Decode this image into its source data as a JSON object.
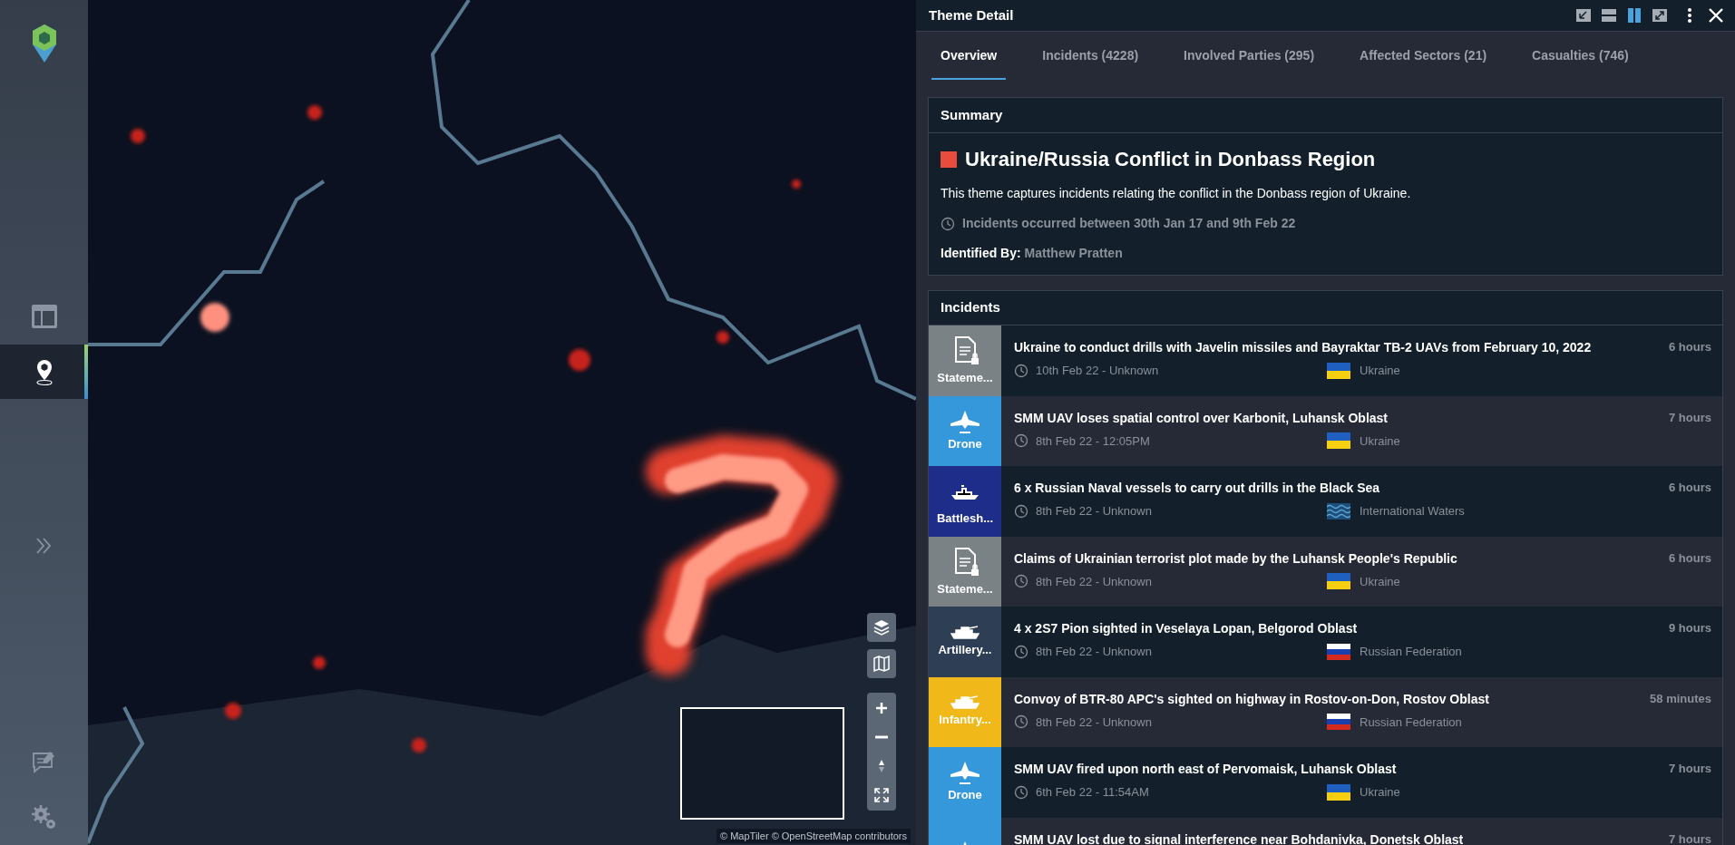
{
  "sidebar": {
    "items": [
      {
        "kind": "layout",
        "selected": false
      },
      {
        "kind": "pin",
        "selected": true
      }
    ],
    "bottom": [
      {
        "kind": "expand"
      },
      {
        "kind": "chat"
      },
      {
        "kind": "settings"
      }
    ]
  },
  "map": {
    "attribution": "© MapTiler © OpenStreetMap contributors"
  },
  "panel": {
    "title": "Theme Detail",
    "view_buttons": [
      {
        "kind": "dock",
        "selected": false
      },
      {
        "kind": "rows",
        "selected": false
      },
      {
        "kind": "columns",
        "selected": true
      },
      {
        "kind": "expand",
        "selected": false
      }
    ]
  },
  "tabs": [
    {
      "label": "Overview",
      "selected": true
    },
    {
      "label": "Incidents (4228)",
      "selected": false
    },
    {
      "label": "Involved Parties (295)",
      "selected": false
    },
    {
      "label": "Affected Sectors (21)",
      "selected": false
    },
    {
      "label": "Casualties (746)",
      "selected": false
    }
  ],
  "summary": {
    "heading": "Summary",
    "title": "Ukraine/Russia Conflict in Donbass Region",
    "description": "This theme captures incidents relating the conflict in the Donbass region of Ukraine.",
    "period": "Incidents occurred between 30th Jan 17 and 9th Feb 22",
    "identified_label": "Identified By:",
    "identified_name": "Matthew Pratten"
  },
  "incidents": {
    "heading": "Incidents",
    "items": [
      {
        "kind": "document",
        "category": "Stateme...",
        "color": "#7a8285",
        "title": "Ukraine to conduct drills with Javelin missiles and Bayraktar TB-2 UAVs from February 10, 2022",
        "date": "10th Feb 22 - Unknown",
        "flag": {
          "kind": "ukraine"
        },
        "country": "Ukraine",
        "age": "6 hours"
      },
      {
        "kind": "drone",
        "category": "Drone",
        "color": "#3498db",
        "title": "SMM UAV loses spatial control over Karbonit, Luhansk Oblast",
        "date": "8th Feb 22 - 12:05PM",
        "flag": {
          "kind": "ukraine"
        },
        "country": "Ukraine",
        "age": "7 hours"
      },
      {
        "kind": "ship",
        "category": "Battlesh...",
        "color": "#1f2d8a",
        "title": "6 x Russian Naval vessels to carry out drills in the Black Sea",
        "date": "8th Feb 22 - Unknown",
        "flag": {
          "kind": "waves"
        },
        "country": "International Waters",
        "age": "6 hours"
      },
      {
        "kind": "document",
        "category": "Stateme...",
        "color": "#7a8285",
        "title": "Claims of Ukrainian terrorist plot made by the Luhansk People's Republic",
        "date": "8th Feb 22 - Unknown",
        "flag": {
          "kind": "ukraine"
        },
        "country": "Ukraine",
        "age": "6 hours"
      },
      {
        "kind": "tank",
        "category": "Artillery...",
        "color": "#2e3e55",
        "title": "4 x 2S7 Pion sighted in Veselaya Lopan, Belgorod Oblast",
        "date": "8th Feb 22 - Unknown",
        "flag": {
          "kind": "russia"
        },
        "country": "Russian Federation",
        "age": "9 hours"
      },
      {
        "kind": "tank",
        "category": "Infantry...",
        "color": "#f0b818",
        "title": "Convoy of BTR-80 APC's sighted on highway in Rostov-on-Don, Rostov Oblast",
        "date": "8th Feb 22 - Unknown",
        "flag": {
          "kind": "russia"
        },
        "country": "Russian Federation",
        "age": "58 minutes"
      },
      {
        "kind": "drone",
        "category": "Drone",
        "color": "#3498db",
        "title": "SMM UAV fired upon north east of Pervomaisk, Luhansk Oblast",
        "date": "6th Feb 22 - 11:54AM",
        "flag": {
          "kind": "ukraine"
        },
        "country": "Ukraine",
        "age": "7 hours"
      },
      {
        "kind": "drone",
        "color": "#3498db",
        "title": "SMM UAV lost due to signal interference near Bohdanivka, Donetsk Oblast",
        "age": "7 hours"
      }
    ]
  }
}
